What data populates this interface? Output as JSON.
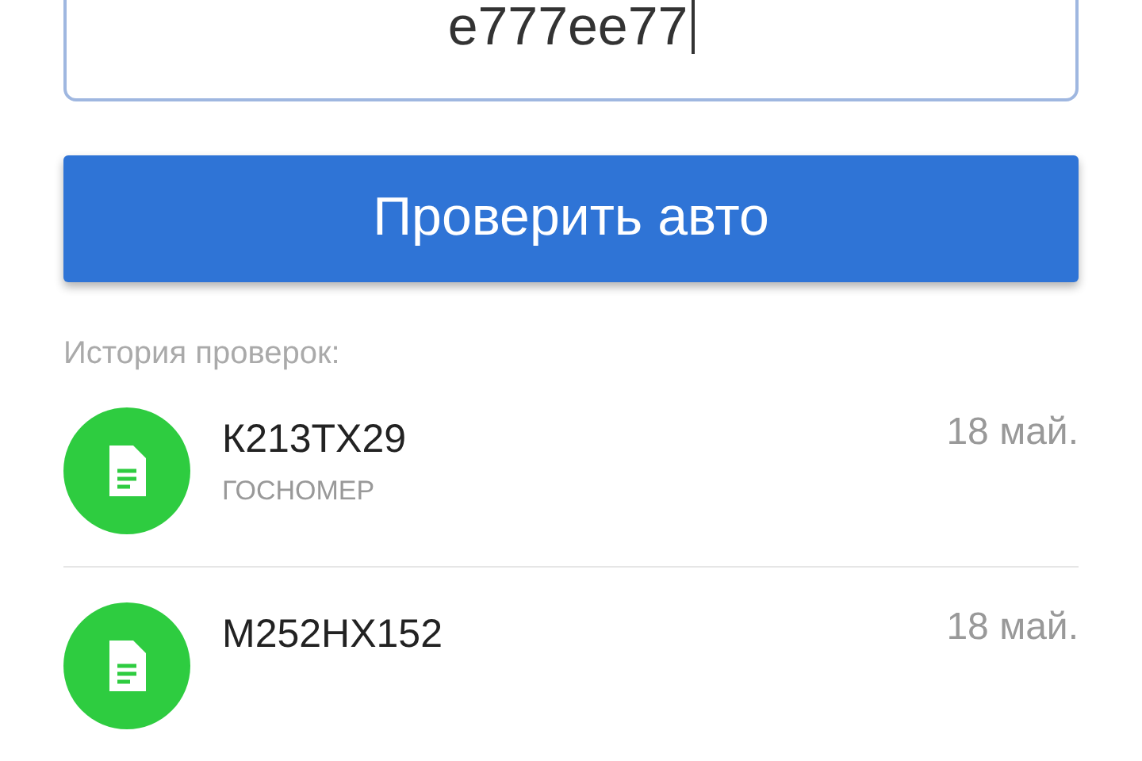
{
  "search": {
    "value": "e777ee77"
  },
  "check_button": {
    "label": "Проверить авто"
  },
  "history": {
    "title": "История проверок:",
    "items": [
      {
        "number": "К213ТХ29",
        "type": "ГОСНОМЕР",
        "date": "18 май."
      },
      {
        "number": "М252НХ152",
        "date": "18 май."
      }
    ]
  }
}
